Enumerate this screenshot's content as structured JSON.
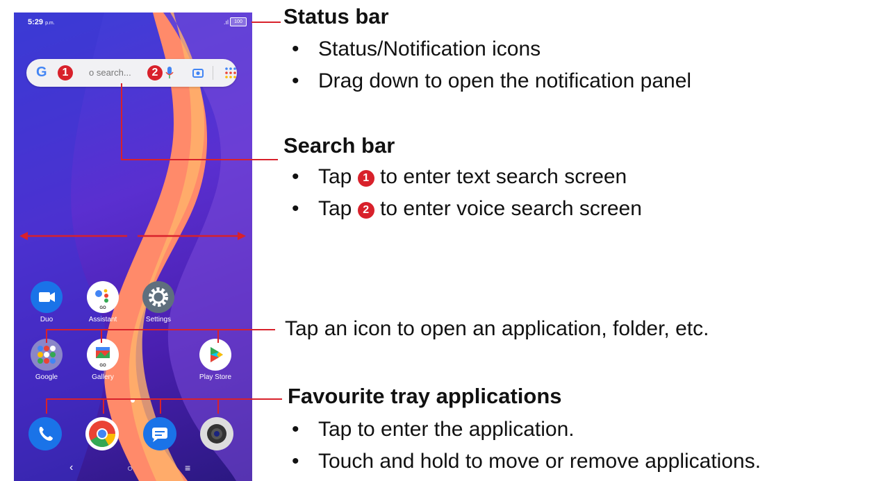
{
  "phone": {
    "status": {
      "time": "5:29",
      "time_suffix": "p.m.",
      "battery": "100"
    },
    "search": {
      "google_letter": "G",
      "badge1": "1",
      "badge2": "2",
      "placeholder": "o search..."
    },
    "apps": [
      {
        "label": "Duo",
        "icon": "video-camera-icon"
      },
      {
        "label": "Assistant",
        "icon": "assistant-icon",
        "go": "GO"
      },
      {
        "label": "Settings",
        "icon": "gear-icon"
      },
      {
        "label": "Google",
        "icon": "google-folder-icon"
      },
      {
        "label": "Gallery",
        "icon": "gallery-icon",
        "go": "GO"
      },
      {
        "label": "Play Store",
        "icon": "play-store-icon"
      }
    ],
    "dock": [
      {
        "icon": "phone-icon"
      },
      {
        "icon": "chrome-icon"
      },
      {
        "icon": "messages-icon"
      },
      {
        "icon": "camera-icon"
      }
    ]
  },
  "annotations": {
    "status_bar": {
      "title": "Status bar",
      "bullets": [
        "Status/Notification icons",
        "Drag down to open the notification panel"
      ]
    },
    "search_bar": {
      "title": "Search bar",
      "tap": "Tap",
      "n1": "1",
      "line1": "to enter text search screen",
      "n2": "2",
      "line2": "to enter voice search screen"
    },
    "tap_icon": "Tap an icon to open an application, folder, etc.",
    "favourite": {
      "title": "Favourite tray applications",
      "bullets": [
        "Tap to enter the application.",
        "Touch and hold to move or remove applications."
      ]
    },
    "bullet": "•"
  },
  "colors": {
    "accent": "#d8212b"
  }
}
